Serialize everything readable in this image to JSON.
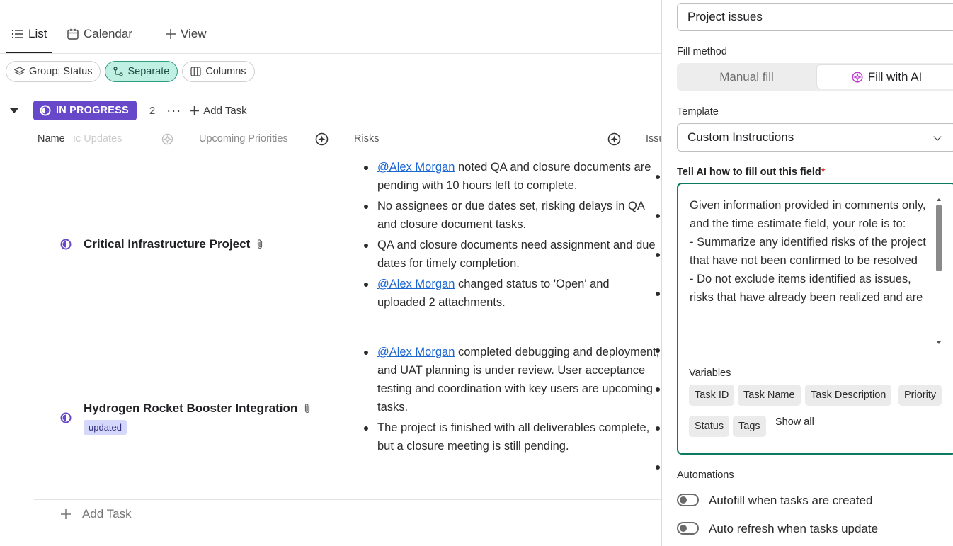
{
  "views": {
    "tabs": [
      {
        "label": "List",
        "icon": "list-icon",
        "active": true
      },
      {
        "label": "Calendar",
        "icon": "calendar-icon",
        "active": false
      }
    ],
    "add_view_label": "View"
  },
  "toolbar": {
    "group_label": "Group: Status",
    "separate_label": "Separate",
    "columns_label": "Columns"
  },
  "group": {
    "status_label": "IN PROGRESS",
    "count": "2",
    "more_label": "···",
    "add_task_label": "Add Task"
  },
  "columns": {
    "name": "Name",
    "updates_fragment": "ıc Updates",
    "upcoming": "Upcoming Priorities",
    "risks": "Risks",
    "issues": "Issu"
  },
  "tasks": [
    {
      "title": "Critical Infrastructure Project",
      "badge": "",
      "risks": [
        {
          "mention": "@Alex Morgan",
          "text": " noted QA and closure documents are pending with 10 hours left to complete."
        },
        {
          "mention": "",
          "text": "No assignees or due dates set, risking delays in QA and closure document tasks."
        },
        {
          "mention": "",
          "text": "QA and closure documents need assignment and due dates for timely completion."
        },
        {
          "mention": "@Alex Morgan",
          "text": " changed status to 'Open' and uploaded 2 attachments."
        }
      ]
    },
    {
      "title": "Hydrogen Rocket Booster Integration",
      "badge": "updated",
      "risks": [
        {
          "mention": "@Alex Morgan",
          "text": " completed debugging and deployment, and UAT planning is under review. User acceptance testing and coordination with key users are upcoming tasks."
        },
        {
          "mention": "",
          "text": "The project is finished with all deliverables complete, but a closure meeting is still pending."
        }
      ]
    }
  ],
  "footer": {
    "add_task_label": "Add Task"
  },
  "panel": {
    "field_name": "Project issues",
    "fill_method_label": "Fill method",
    "manual_fill_label": "Manual fill",
    "ai_fill_label": "Fill with AI",
    "template_label": "Template",
    "template_value": "Custom Instructions",
    "instructions_label": "Tell AI how to fill out this field",
    "required_mark": "*",
    "instructions_text": "Given information provided in comments only, and the time estimate field, your role is to:\n- Summarize any identified risks of the project that have not been confirmed to be resolved\n- Do not exclude items identified as issues, risks that have already been realized and are",
    "variables_label": "Variables",
    "variables": [
      "Task ID",
      "Task Name",
      "Task Description",
      "Priority",
      "Status",
      "Tags"
    ],
    "show_all_label": "Show all",
    "automations_label": "Automations",
    "autofill_label": "Autofill when tasks are created",
    "autorefresh_label": "Auto refresh when tasks update"
  },
  "colors": {
    "accent_teal": "#0f7a63",
    "status_purple": "#6748c9",
    "mention_blue": "#1a66d1"
  }
}
